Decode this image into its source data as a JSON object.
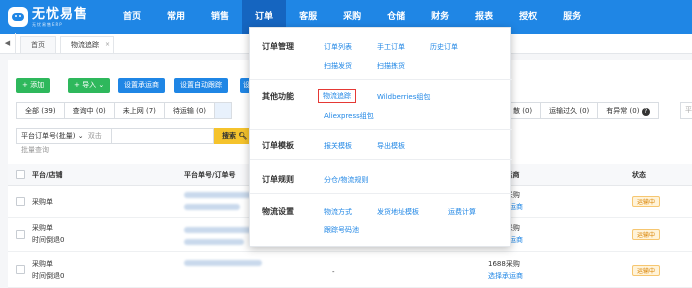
{
  "app": {
    "brand_title": "无忧易售",
    "brand_sub": "无忧易售ERP"
  },
  "nav": [
    "首页",
    "常用",
    "销售",
    "订单",
    "客服",
    "采购",
    "仓储",
    "财务",
    "报表",
    "授权",
    "服务"
  ],
  "nav_active": "订单",
  "tabs": [
    {
      "label": "首页"
    },
    {
      "label": "物流追踪",
      "close": "×"
    }
  ],
  "toolbar": {
    "add": "+ 添加",
    "import": "+ 导入 ⌄",
    "set_carrier": "设置承运商",
    "set_auto_track": "设置自动跟踪",
    "more": "设"
  },
  "filters": {
    "all": "全部 (39)",
    "querying": "查询中 (0)",
    "not_online": "未上网 (7)",
    "pending_transport": "待运输 (0)",
    "partial": "散 (0)",
    "transport_overtime": "运输过久 (0)",
    "abnormal": "有异常 (0)",
    "help_icon_char": "?",
    "platform_placeholder": "平台"
  },
  "search": {
    "select_value": "平台订单号(批量)",
    "placeholder": "双击批量查询",
    "button": "搜索"
  },
  "table": {
    "headers": [
      "平台/店铺",
      "平台单号/订单号",
      "/承运商",
      "状态"
    ],
    "rows": [
      {
        "store": "采购单",
        "sub": "",
        "carrier_top": "1688采购",
        "carrier_link": "选择承运商",
        "status": "运输中"
      },
      {
        "store": "采购单",
        "sub": "时间倒退0",
        "carrier_top": "1688采购",
        "carrier_link": "选择承运商",
        "status": "运输中"
      },
      {
        "store": "采购单",
        "sub": "时间倒退0",
        "mid": "-",
        "carrier_top": "1688采购",
        "carrier_link": "选择承运商",
        "status": "运输中"
      }
    ]
  },
  "menu": {
    "order_mgmt": {
      "title": "订单管理",
      "items": [
        "订单列表",
        "手工订单",
        "历史订单",
        "扫描发货",
        "扫描拣货"
      ]
    },
    "other": {
      "title": "其他功能",
      "items": [
        "物流追踪",
        "Wildberries组包",
        "Aliexpress组包"
      ]
    },
    "template": {
      "title": "订单模板",
      "items": [
        "报关模板",
        "导出模板"
      ]
    },
    "rules": {
      "title": "订单规则",
      "items": [
        "分仓/物流规则"
      ]
    },
    "logistics": {
      "title": "物流设置",
      "items": [
        "物流方式",
        "发货地址模板",
        "运费计算",
        "跟踪号码池"
      ]
    }
  },
  "colors": {
    "brand": "#1f86e5",
    "nav_active": "#1565c0",
    "green": "#2eb85c",
    "status_orange": "#d98200",
    "highlight_red": "#e53935"
  }
}
